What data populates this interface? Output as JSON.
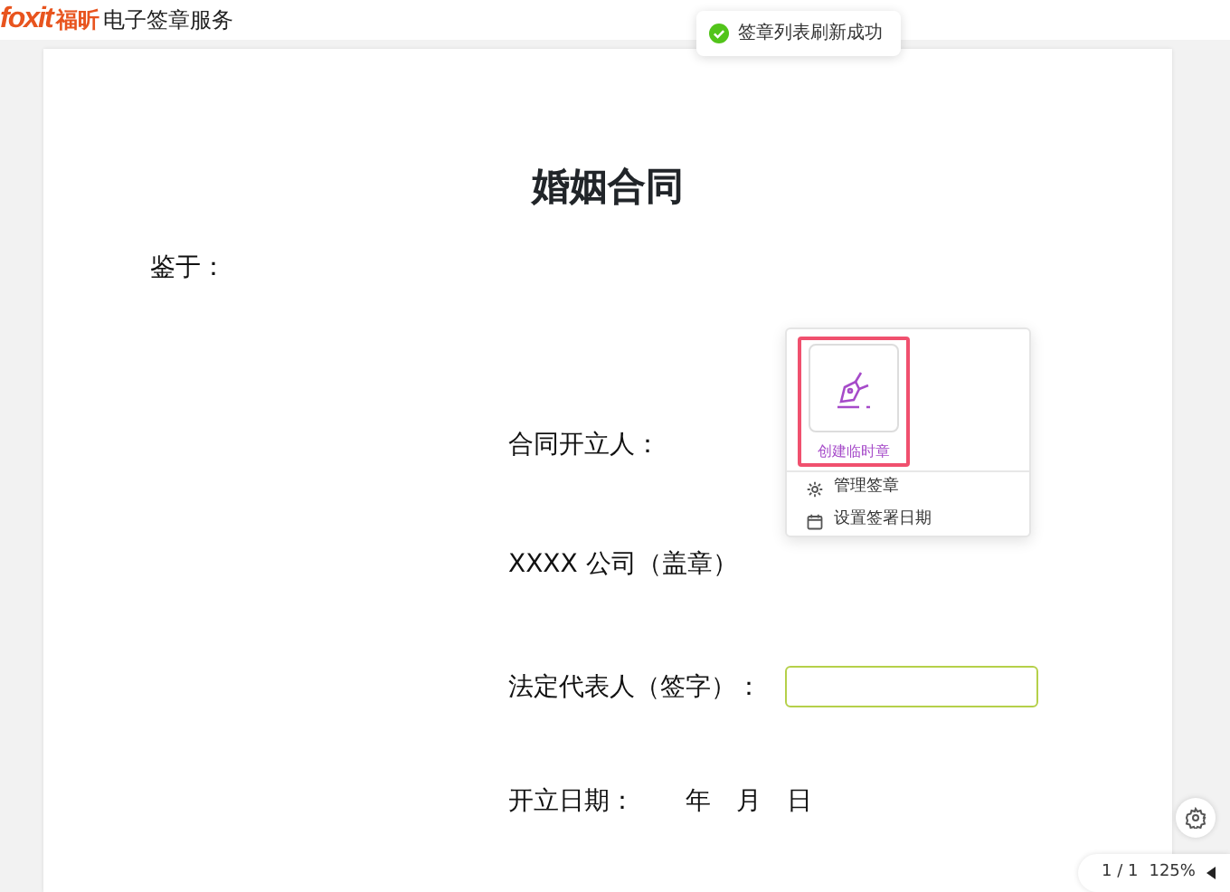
{
  "header": {
    "logo": "foxit",
    "brand": "福昕",
    "service": "电子签章服务"
  },
  "toast": {
    "message": "签章列表刷新成功"
  },
  "document": {
    "title": "婚姻合同",
    "preamble": "鉴于：",
    "issuer_label": "合同开立人：",
    "company": "XXXX 公司（盖章）",
    "representative_label": "法定代表人（签字）：",
    "date_label": "开立日期：",
    "date_parts": [
      "年",
      "月",
      "日"
    ]
  },
  "popup": {
    "tiles": [
      {
        "label": "创建临时章",
        "selected": true
      }
    ],
    "menu": [
      {
        "kind": "settings",
        "label": "管理签章"
      },
      {
        "kind": "calendar",
        "label": "设置签署日期"
      }
    ]
  },
  "pager": {
    "page": "1 / 1",
    "zoom": "125%"
  }
}
